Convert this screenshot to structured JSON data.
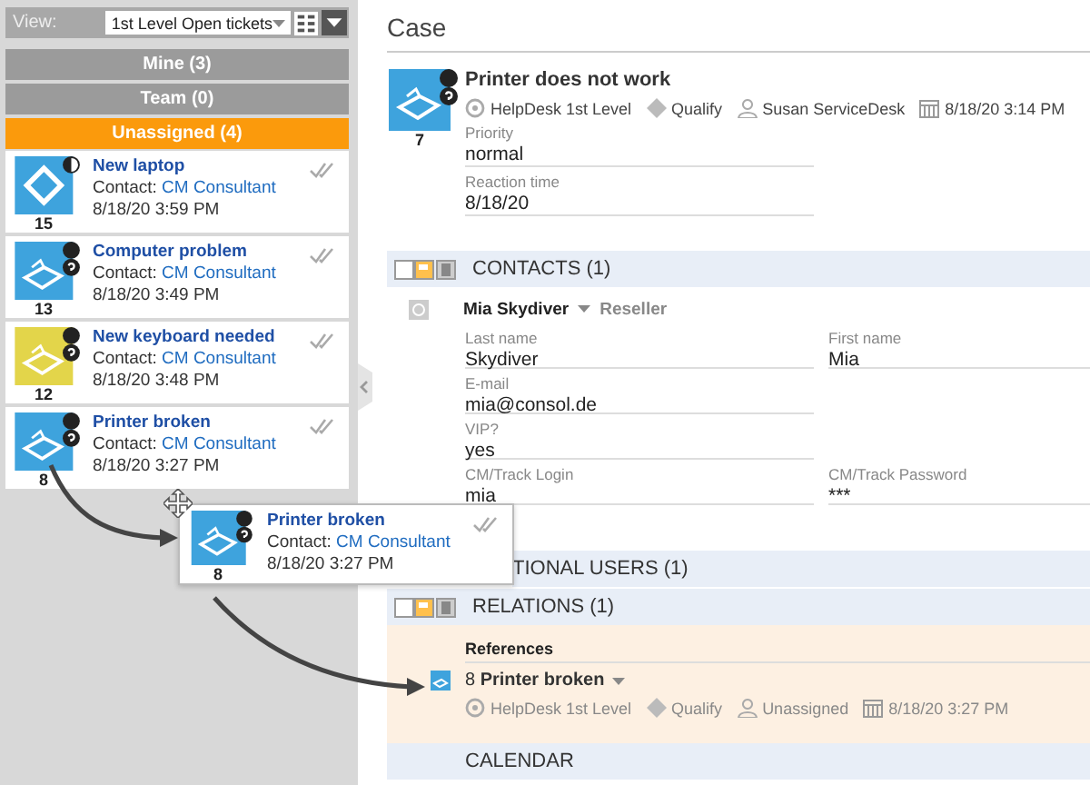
{
  "view": {
    "label": "View:",
    "value": "1st Level Open tickets"
  },
  "tabs": [
    {
      "label": "Mine (3)",
      "selected": false
    },
    {
      "label": "Team (0)",
      "selected": false
    },
    {
      "label": "Unassigned (4)",
      "selected": true
    }
  ],
  "tickets": [
    {
      "kind": "diamond",
      "color": "#3ea3dd",
      "number": "15",
      "title": "New laptop",
      "contact_label": "Contact:",
      "contact": "CM Consultant",
      "date": "8/18/20 3:59 PM"
    },
    {
      "kind": "printer",
      "color": "#3ea3dd",
      "number": "13",
      "title": "Computer problem",
      "contact_label": "Contact:",
      "contact": "CM Consultant",
      "date": "8/18/20 3:49 PM"
    },
    {
      "kind": "printer",
      "color": "#e3d54a",
      "number": "12",
      "title": "New keyboard needed",
      "contact_label": "Contact:",
      "contact": "CM Consultant",
      "date": "8/18/20 3:48 PM"
    },
    {
      "kind": "printer",
      "color": "#3ea3dd",
      "number": "8",
      "title": "Printer broken",
      "contact_label": "Contact:",
      "contact": "CM Consultant",
      "date": "8/18/20 3:27 PM"
    }
  ],
  "case": {
    "heading": "Case",
    "title": "Printer does not work",
    "number": "7",
    "meta": [
      {
        "kind": "queue",
        "text": "HelpDesk 1st Level"
      },
      {
        "kind": "state",
        "text": "Qualify"
      },
      {
        "kind": "user",
        "text": "Susan ServiceDesk"
      },
      {
        "kind": "date",
        "text": "8/18/20 3:14 PM"
      }
    ],
    "fields": [
      {
        "label": "Priority",
        "value": "normal"
      },
      {
        "label": "Reaction time",
        "value": "8/18/20"
      }
    ]
  },
  "contacts": {
    "header": "CONTACTS (1)",
    "name": "Mia Skydiver",
    "role": "Reseller",
    "rows": [
      [
        {
          "label": "Last name",
          "value": "Skydiver"
        },
        {
          "label": "First name",
          "value": "Mia"
        }
      ],
      [
        {
          "label": "E-mail",
          "value": "mia@consol.de"
        }
      ],
      [
        {
          "label": "VIP?",
          "value": "yes"
        }
      ],
      [
        {
          "label": "CM/Track Login",
          "value": "mia"
        },
        {
          "label": "CM/Track Password",
          "value": "***"
        }
      ]
    ]
  },
  "additional_users": {
    "header": "TIONAL USERS (1)"
  },
  "relations": {
    "header": "RELATIONS (1)",
    "references_label": "References",
    "reference_title": "8 **Printer broken**",
    "meta": [
      {
        "kind": "queue",
        "text": "HelpDesk 1st Level"
      },
      {
        "kind": "state",
        "text": "Qualify"
      },
      {
        "kind": "user",
        "text": "Unassigned"
      },
      {
        "kind": "date",
        "text": "8/18/20 3:27 PM"
      }
    ]
  },
  "calendar": {
    "header": "CALENDAR"
  },
  "drag_card": {
    "kind": "printer",
    "color": "#3ea3dd",
    "number": "8",
    "title": "Printer broken",
    "contact_label": "Contact:",
    "contact": "CM Consultant",
    "date": "8/18/20 3:27 PM"
  }
}
